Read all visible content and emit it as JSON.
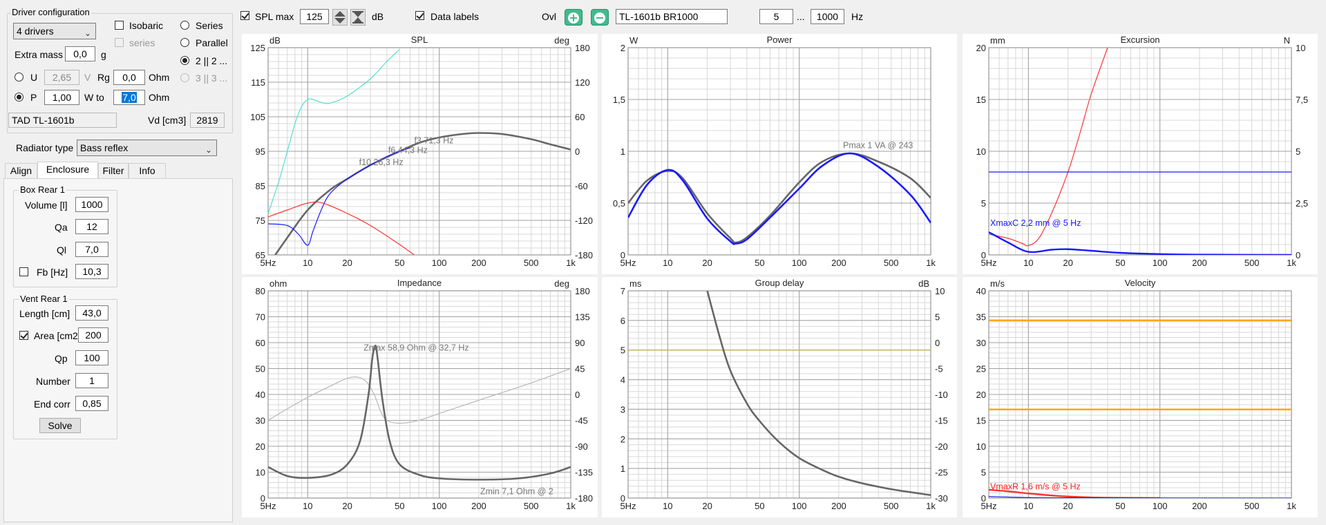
{
  "toolbar": {
    "spl_max_label": "SPL max",
    "spl_max_value": "125",
    "spl_unit": "dB",
    "data_labels_label": "Data labels",
    "ovl_label": "Ovl",
    "design_name": "TL-1601b BR1000",
    "freq_from": "5",
    "freq_sep": "...",
    "freq_to": "1000",
    "freq_unit": "Hz"
  },
  "driver": {
    "group_title": "Driver configuration",
    "count_value": "4 drivers",
    "isobaric_label": "Isobaric",
    "series_check_label": "series",
    "series_label": "Series",
    "parallel_label": "Parallel",
    "combo1_label": "2 || 2 ...",
    "combo2_label": "3 || 3 ...",
    "extra_mass_label": "Extra mass",
    "extra_mass_value": "0,0",
    "extra_mass_unit": "g",
    "u_label": "U",
    "u_value": "2,65",
    "u_unit": "V",
    "rg_label": "Rg",
    "rg_value": "0,0",
    "rg_unit": "Ohm",
    "p_label": "P",
    "p_value": "1,00",
    "p_unit": "W to",
    "p_to_value": "7,0",
    "p_to_unit": "Ohm",
    "model": "TAD TL-1601b",
    "vd_label": "Vd [cm3]",
    "vd_value": "2819"
  },
  "radiator": {
    "label": "Radiator type",
    "value": "Bass reflex"
  },
  "tabs": [
    "Align",
    "Enclosure",
    "Filter",
    "Info"
  ],
  "box": {
    "title": "Box Rear 1",
    "volume_label": "Volume [l]",
    "volume_value": "1000",
    "qa_label": "Qa",
    "qa_value": "12",
    "ql_label": "Ql",
    "ql_value": "7,0",
    "fb_label": "Fb [Hz]",
    "fb_value": "10,3"
  },
  "vent": {
    "title": "Vent Rear 1",
    "length_label": "Length [cm]",
    "length_value": "43,0",
    "area_label": "Area [cm2",
    "area_value": "200",
    "qp_label": "Qp",
    "qp_value": "100",
    "number_label": "Number",
    "number_value": "1",
    "endcorr_label": "End corr",
    "endcorr_value": "0,85",
    "solve_label": "Solve"
  },
  "colors": {
    "grid_major": "#a0a0a0",
    "grid_minor": "#d8d8d8",
    "gray_curve": "#666666",
    "blue_curve": "#1a1aff",
    "cyan_curve": "#50e0d0",
    "red_curve": "#ff3333",
    "orange_line": "#ffa500",
    "olive_line": "#c8b040",
    "light_gray_curve": "#bbbbbb",
    "green_button": "#3fbb8f"
  },
  "chart_data": [
    {
      "id": "spl",
      "type": "line",
      "title": "SPL",
      "left_unit": "dB",
      "right_unit": "deg",
      "x_ticks": [
        "5Hz",
        "10",
        "20",
        "50",
        "100",
        "200",
        "500",
        "1k"
      ],
      "xlim": [
        5,
        1000
      ],
      "ylim": [
        65,
        125
      ],
      "y_ticks": [
        "65",
        "75",
        "85",
        "95",
        "105",
        "115",
        "125"
      ],
      "y2lim": [
        -180,
        180
      ],
      "y2_ticks": [
        "-180",
        "-120",
        "-60",
        "0",
        "60",
        "120",
        "180"
      ],
      "annotations": [
        "f3 71,3 Hz",
        "f6 44,3 Hz",
        "f10 26,3 Hz"
      ],
      "series": [
        {
          "color": "gray_curve",
          "axis": "left",
          "width": 2.6,
          "points": [
            [
              5,
              62
            ],
            [
              7,
              70
            ],
            [
              10,
              78
            ],
            [
              15,
              84
            ],
            [
              20,
              87
            ],
            [
              30,
              91
            ],
            [
              50,
              95
            ],
            [
              71,
              97.5
            ],
            [
              100,
              99
            ],
            [
              150,
              100
            ],
            [
              200,
              100.3
            ],
            [
              300,
              100
            ],
            [
              500,
              98.5
            ],
            [
              700,
              97
            ],
            [
              1000,
              95.5
            ]
          ]
        },
        {
          "color": "blue_curve",
          "axis": "left",
          "width": 1.2,
          "points": [
            [
              5,
              74
            ],
            [
              7,
              73.5
            ],
            [
              8.5,
              71
            ],
            [
              10,
              67.8
            ],
            [
              11,
              72
            ],
            [
              13,
              79
            ],
            [
              15,
              83
            ],
            [
              20,
              87
            ],
            [
              30,
              91
            ],
            [
              40,
              93.5
            ],
            [
              50,
              95
            ],
            [
              60,
              96
            ]
          ]
        },
        {
          "color": "cyan_curve",
          "axis": "left",
          "width": 1.2,
          "points": [
            [
              5,
              77
            ],
            [
              6,
              86
            ],
            [
              7,
              95
            ],
            [
              8,
              103
            ],
            [
              9,
              108
            ],
            [
              10,
              110
            ],
            [
              11,
              110
            ],
            [
              13,
              109
            ],
            [
              15,
              109
            ],
            [
              20,
              111
            ],
            [
              30,
              116
            ],
            [
              40,
              121
            ],
            [
              50,
              124.5
            ]
          ]
        },
        {
          "color": "red_curve",
          "axis": "left",
          "width": 1.2,
          "points": [
            [
              5,
              76
            ],
            [
              7,
              78
            ],
            [
              10,
              80
            ],
            [
              13,
              80
            ],
            [
              20,
              77
            ],
            [
              30,
              73.5
            ],
            [
              50,
              68
            ],
            [
              70,
              64
            ]
          ]
        }
      ]
    },
    {
      "id": "power",
      "type": "line",
      "title": "Power",
      "left_unit": "W",
      "right_unit": "",
      "x_ticks": [
        "5Hz",
        "10",
        "20",
        "50",
        "100",
        "200",
        "500",
        "1k"
      ],
      "xlim": [
        5,
        1000
      ],
      "ylim": [
        0,
        2
      ],
      "y_ticks": [
        "0",
        "0,5",
        "1",
        "1,5",
        "2"
      ],
      "annotations": [
        "Pmax 1 VA  @ 243"
      ],
      "series": [
        {
          "color": "gray_curve",
          "axis": "left",
          "width": 2.6,
          "points": [
            [
              5,
              0.5
            ],
            [
              7,
              0.72
            ],
            [
              10,
              0.81
            ],
            [
              13,
              0.74
            ],
            [
              20,
              0.4
            ],
            [
              30,
              0.16
            ],
            [
              33,
              0.12
            ],
            [
              40,
              0.17
            ],
            [
              60,
              0.38
            ],
            [
              100,
              0.7
            ],
            [
              150,
              0.9
            ],
            [
              243,
              0.98
            ],
            [
              400,
              0.9
            ],
            [
              700,
              0.74
            ],
            [
              1000,
              0.55
            ]
          ]
        },
        {
          "color": "blue_curve",
          "axis": "left",
          "width": 2.6,
          "points": [
            [
              5,
              0.36
            ],
            [
              7,
              0.68
            ],
            [
              10,
              0.82
            ],
            [
              13,
              0.72
            ],
            [
              20,
              0.35
            ],
            [
              30,
              0.13
            ],
            [
              33,
              0.11
            ],
            [
              40,
              0.15
            ],
            [
              60,
              0.36
            ],
            [
              100,
              0.64
            ],
            [
              150,
              0.86
            ],
            [
              243,
              0.98
            ],
            [
              400,
              0.85
            ],
            [
              700,
              0.58
            ],
            [
              1000,
              0.31
            ]
          ]
        }
      ]
    },
    {
      "id": "excursion",
      "type": "line",
      "title": "Excursion",
      "left_unit": "mm",
      "right_unit": "N",
      "x_ticks": [
        "5Hz",
        "10",
        "20",
        "50",
        "100",
        "200",
        "500",
        "1k"
      ],
      "xlim": [
        5,
        1000
      ],
      "ylim": [
        0,
        20
      ],
      "y_ticks": [
        "0",
        "5",
        "10",
        "15",
        "20"
      ],
      "y2lim": [
        0,
        10
      ],
      "y2_ticks": [
        "0",
        "2,5",
        "5",
        "7,5",
        "10"
      ],
      "annotations": [
        "XmaxC 2,2 mm  @ 5 Hz"
      ],
      "series": [
        {
          "color": "red_curve",
          "axis": "left",
          "width": 1.2,
          "points": [
            [
              5,
              2
            ],
            [
              7,
              1.6
            ],
            [
              9,
              1.1
            ],
            [
              10,
              0.9
            ],
            [
              12,
              1.6
            ],
            [
              15,
              4
            ],
            [
              20,
              8
            ],
            [
              25,
              12
            ],
            [
              30,
              15.5
            ],
            [
              40,
              20
            ]
          ]
        },
        {
          "color": "blue_curve",
          "axis": "left",
          "width": 1.2,
          "points": [
            [
              5,
              8
            ],
            [
              1000,
              8
            ]
          ]
        },
        {
          "color": "blue_curve",
          "axis": "left",
          "width": 2.4,
          "points": [
            [
              5,
              2.2
            ],
            [
              7,
              1.2
            ],
            [
              10,
              0.3
            ],
            [
              15,
              0.5
            ],
            [
              20,
              0.55
            ],
            [
              30,
              0.4
            ],
            [
              50,
              0.2
            ],
            [
              100,
              0.08
            ],
            [
              200,
              0.03
            ],
            [
              1000,
              0
            ]
          ]
        }
      ]
    },
    {
      "id": "impedance",
      "type": "line",
      "title": "Impedance",
      "left_unit": "ohm",
      "right_unit": "deg",
      "x_ticks": [
        "5Hz",
        "10",
        "20",
        "50",
        "100",
        "200",
        "500",
        "1k"
      ],
      "xlim": [
        5,
        1000
      ],
      "ylim": [
        0,
        80
      ],
      "y_ticks": [
        "0",
        "10",
        "20",
        "30",
        "40",
        "50",
        "60",
        "70",
        "80"
      ],
      "y2lim": [
        -180,
        180
      ],
      "y2_ticks": [
        "-180",
        "-135",
        "-90",
        "-45",
        "0",
        "45",
        "90",
        "135",
        "180"
      ],
      "annotations": [
        "Zmax 58,9 Ohm @ 32,7 Hz",
        "Zmin 7,1 Ohm @ 2"
      ],
      "series": [
        {
          "color": "light_gray_curve",
          "axis": "right",
          "width": 1.3,
          "points": [
            [
              5,
              -45
            ],
            [
              7,
              -25
            ],
            [
              10,
              -5
            ],
            [
              15,
              15
            ],
            [
              20,
              28
            ],
            [
              24,
              30
            ],
            [
              28,
              22
            ],
            [
              32,
              0
            ],
            [
              36,
              -30
            ],
            [
              40,
              -45
            ],
            [
              50,
              -50
            ],
            [
              70,
              -45
            ],
            [
              100,
              -33
            ],
            [
              200,
              -10
            ],
            [
              500,
              20
            ],
            [
              1000,
              45
            ]
          ]
        },
        {
          "color": "gray_curve",
          "axis": "left",
          "width": 2.6,
          "points": [
            [
              5,
              12
            ],
            [
              7,
              8.5
            ],
            [
              10,
              7.8
            ],
            [
              15,
              9
            ],
            [
              20,
              13
            ],
            [
              25,
              22
            ],
            [
              29,
              40
            ],
            [
              31,
              54
            ],
            [
              32.7,
              58.9
            ],
            [
              34,
              54
            ],
            [
              37,
              38
            ],
            [
              42,
              22
            ],
            [
              50,
              13
            ],
            [
              70,
              9
            ],
            [
              100,
              7.6
            ],
            [
              200,
              7.1
            ],
            [
              400,
              7.6
            ],
            [
              700,
              9.5
            ],
            [
              1000,
              12
            ]
          ]
        }
      ]
    },
    {
      "id": "group_delay",
      "type": "line",
      "title": "Group delay",
      "left_unit": "ms",
      "right_unit": "dB",
      "x_ticks": [
        "5Hz",
        "10",
        "20",
        "50",
        "100",
        "200",
        "500",
        "1k"
      ],
      "xlim": [
        5,
        1000
      ],
      "ylim": [
        0,
        7
      ],
      "y_ticks": [
        "0",
        "1",
        "2",
        "3",
        "4",
        "5",
        "6",
        "7"
      ],
      "y2lim": [
        -30,
        10
      ],
      "y2_ticks": [
        "-30",
        "-25",
        "-20",
        "-15",
        "-10",
        "-5",
        "0",
        "5",
        "10"
      ],
      "annotations": [],
      "series": [
        {
          "color": "olive_line",
          "axis": "left",
          "width": 1.2,
          "points": [
            [
              5,
              5
            ],
            [
              1000,
              5
            ]
          ]
        },
        {
          "color": "gray_curve",
          "axis": "left",
          "width": 2.6,
          "points": [
            [
              20,
              7
            ],
            [
              25,
              5.4
            ],
            [
              30,
              4.3
            ],
            [
              40,
              3.2
            ],
            [
              50,
              2.6
            ],
            [
              70,
              1.9
            ],
            [
              100,
              1.35
            ],
            [
              150,
              0.95
            ],
            [
              200,
              0.72
            ],
            [
              300,
              0.5
            ],
            [
              500,
              0.3
            ],
            [
              700,
              0.2
            ],
            [
              1000,
              0.1
            ]
          ]
        }
      ]
    },
    {
      "id": "velocity",
      "type": "line",
      "title": "Velocity",
      "left_unit": "m/s",
      "right_unit": "",
      "x_ticks": [
        "5Hz",
        "10",
        "20",
        "50",
        "100",
        "200",
        "500",
        "1k"
      ],
      "xlim": [
        5,
        1000
      ],
      "ylim": [
        0,
        40
      ],
      "y_ticks": [
        "0",
        "5",
        "10",
        "15",
        "20",
        "25",
        "30",
        "35",
        "40"
      ],
      "annotations": [
        "VmaxR 1,6 m/s @ 5 Hz"
      ],
      "series": [
        {
          "color": "orange_line",
          "axis": "left",
          "width": 2.4,
          "points": [
            [
              5,
              34.3
            ],
            [
              1000,
              34.3
            ]
          ]
        },
        {
          "color": "orange_line",
          "axis": "left",
          "width": 2.4,
          "points": [
            [
              5,
              17.1
            ],
            [
              1000,
              17.1
            ]
          ]
        },
        {
          "color": "red_curve",
          "axis": "left",
          "width": 2.4,
          "points": [
            [
              5,
              1.6
            ],
            [
              7,
              1.3
            ],
            [
              10,
              0.9
            ],
            [
              15,
              0.5
            ],
            [
              20,
              0.3
            ],
            [
              30,
              0.12
            ],
            [
              50,
              0.04
            ],
            [
              100,
              0
            ]
          ]
        },
        {
          "color": "blue_curve",
          "axis": "left",
          "width": 1.2,
          "points": [
            [
              5,
              0.3
            ],
            [
              10,
              0.1
            ],
            [
              20,
              0.05
            ],
            [
              1000,
              0
            ]
          ]
        }
      ]
    }
  ]
}
